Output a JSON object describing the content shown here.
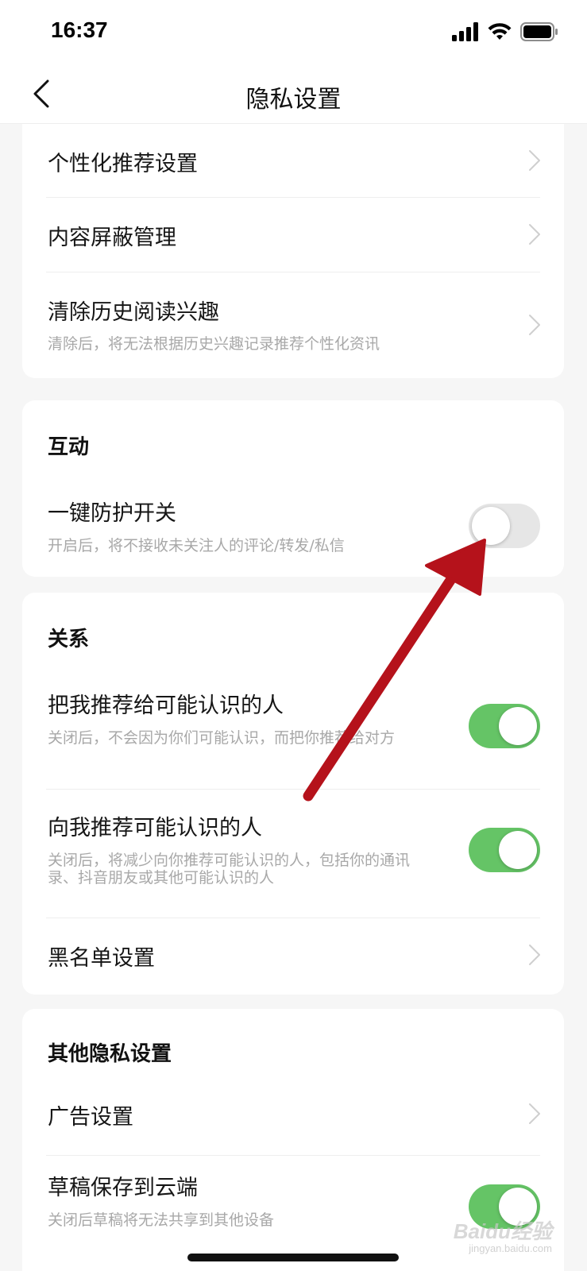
{
  "status_bar": {
    "time": "16:37"
  },
  "nav": {
    "title": "隐私设置"
  },
  "recommend_card": {
    "items": [
      {
        "title": "个性化推荐设置"
      },
      {
        "title": "内容屏蔽管理"
      },
      {
        "title": "清除历史阅读兴趣",
        "desc": "清除后，将无法根据历史兴趣记录推荐个性化资讯"
      }
    ]
  },
  "interaction_card": {
    "title": "互动",
    "items": [
      {
        "title": "一键防护开关",
        "desc": "开启后，将不接收未关注人的评论/转发/私信",
        "enabled": false
      }
    ]
  },
  "relation_card": {
    "title": "关系",
    "items": [
      {
        "title": "把我推荐给可能认识的人",
        "desc": "关闭后，不会因为你们可能认识，而把你推荐给对方",
        "enabled": true
      },
      {
        "title": "向我推荐可能认识的人",
        "desc": "关闭后，将减少向你推荐可能认识的人，包括你的通讯录、抖音朋友或其他可能认识的人",
        "enabled": true
      },
      {
        "title": "黑名单设置"
      }
    ]
  },
  "other_card": {
    "title": "其他隐私设置",
    "items": [
      {
        "title": "广告设置"
      },
      {
        "title": "草稿保存到云端",
        "desc": "关闭后草稿将无法共享到其他设备",
        "enabled": true
      }
    ]
  },
  "watermark": {
    "brand": "Baidu经验",
    "url": "jingyan.baidu.com"
  },
  "colors": {
    "toggle_on": "#65c466",
    "toggle_off": "#e6e6e6",
    "arrow": "#c0141c",
    "background": "#f6f6f6"
  }
}
